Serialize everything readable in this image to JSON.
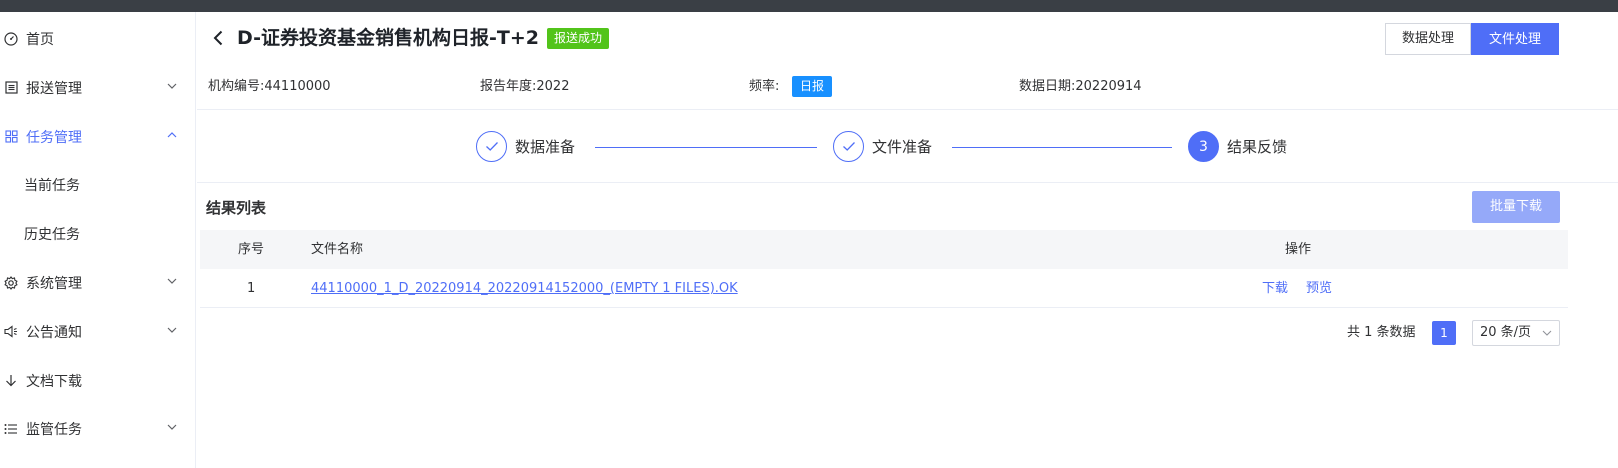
{
  "sidebar": {
    "items": [
      {
        "label": "首页",
        "icon": "dashboard-icon"
      },
      {
        "label": "报送管理",
        "icon": "report-icon"
      },
      {
        "label": "任务管理",
        "icon": "grid-icon",
        "active": true
      },
      {
        "label": "当前任务"
      },
      {
        "label": "历史任务"
      },
      {
        "label": "系统管理",
        "icon": "gear-icon"
      },
      {
        "label": "公告通知",
        "icon": "speaker-icon"
      },
      {
        "label": "文档下载",
        "icon": "download-arrow-icon"
      },
      {
        "label": "监管任务",
        "icon": "list-icon"
      }
    ]
  },
  "header": {
    "title": "D-证券投资基金销售机构日报-T+2",
    "status_badge": "报送成功",
    "btn_data_processing": "数据处理",
    "btn_file_processing": "文件处理"
  },
  "info": {
    "org_code_label": "机构编号:",
    "org_code": "44110000",
    "report_year_label": "报告年度:",
    "report_year": "2022",
    "frequency_label": "频率:",
    "frequency": "日报",
    "data_date_label": "数据日期:",
    "data_date": "20220914"
  },
  "steps": [
    {
      "label": "数据准备",
      "status": "done"
    },
    {
      "label": "文件准备",
      "status": "done"
    },
    {
      "label": "结果反馈",
      "status": "current",
      "number": "3"
    }
  ],
  "results": {
    "title": "结果列表",
    "batch_download": "批量下载",
    "columns": [
      "序号",
      "文件名称",
      "操作"
    ],
    "rows": [
      {
        "index": "1",
        "file_name": "44110000_1_D_20220914_20220914152000_(EMPTY 1 FILES).OK",
        "download": "下载",
        "preview": "预览"
      }
    ]
  },
  "pagination": {
    "total_text": "共 1 条数据",
    "current_page": "1",
    "page_size": "20 条/页"
  },
  "colors": {
    "primary": "#4f6ef7",
    "success": "#52c41a",
    "tag_blue": "#1890ff"
  }
}
